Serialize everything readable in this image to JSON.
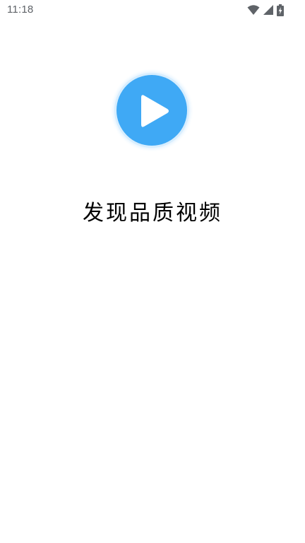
{
  "status_bar": {
    "time": "11:18",
    "icons": [
      "wifi-icon",
      "signal-icon",
      "battery-charging-icon"
    ]
  },
  "splash": {
    "logo": "play-icon",
    "logo_color": "#3fa9f5",
    "slogan": "发现品质视频"
  }
}
